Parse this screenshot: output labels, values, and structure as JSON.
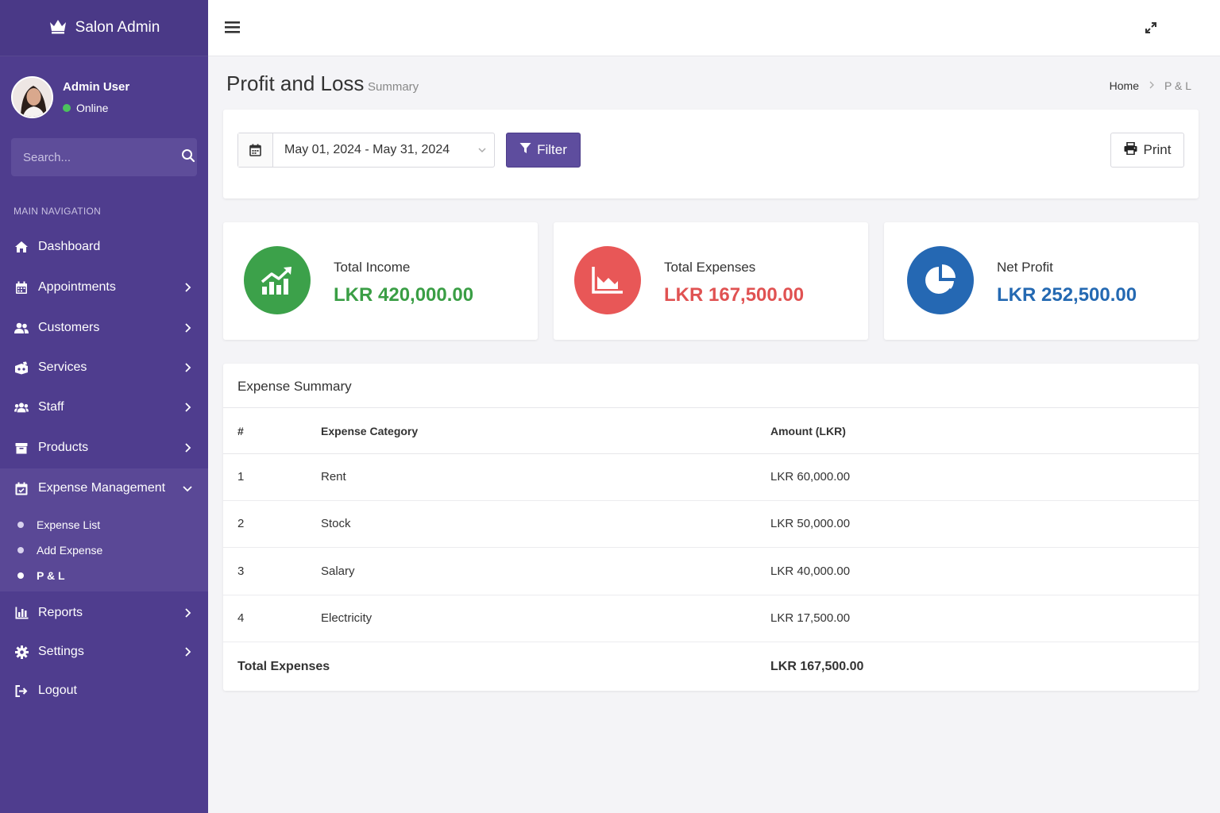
{
  "sidebar": {
    "brand": "Salon Admin",
    "user": {
      "name": "Admin User",
      "status": "Online"
    },
    "search_placeholder": "Search...",
    "nav_header": "MAIN NAVIGATION",
    "items": [
      {
        "label": "Dashboard",
        "icon": "home-icon"
      },
      {
        "label": "Appointments",
        "icon": "calendar-icon"
      },
      {
        "label": "Customers",
        "icon": "users-icon"
      },
      {
        "label": "Services",
        "icon": "services-icon"
      },
      {
        "label": "Staff",
        "icon": "staff-icon"
      },
      {
        "label": "Products",
        "icon": "box-icon"
      },
      {
        "label": "Expense Management",
        "icon": "wallet-icon"
      },
      {
        "label": "Reports",
        "icon": "bar-chart-icon"
      },
      {
        "label": "Settings",
        "icon": "gear-icon"
      },
      {
        "label": "Logout",
        "icon": "sign-out-icon"
      }
    ],
    "sub_items": [
      {
        "label": "Expense List"
      },
      {
        "label": "Add Expense"
      },
      {
        "label": "P & L"
      }
    ]
  },
  "header": {
    "title": "Profit and Loss",
    "subtitle": "Summary",
    "breadcrumb": {
      "home": "Home",
      "current": "P & L"
    }
  },
  "filter": {
    "date_range": "May 01, 2024 - May 31, 2024",
    "filter_label": "Filter",
    "print_label": "Print"
  },
  "stats": [
    {
      "label": "Total Income",
      "value": "LKR 420,000.00",
      "color": "#3a9e45"
    },
    {
      "label": "Total Expenses",
      "value": "LKR 167,500.00",
      "color": "#e05252"
    },
    {
      "label": "Net Profit",
      "value": "LKR 252,500.00",
      "color": "#2469b2"
    }
  ],
  "table": {
    "title": "Expense Summary",
    "columns": [
      "#",
      "Expense Category",
      "Amount (LKR)"
    ],
    "rows": [
      {
        "num": "1",
        "category": "Rent",
        "amount": "LKR 60,000.00"
      },
      {
        "num": "2",
        "category": "Stock",
        "amount": "LKR 50,000.00"
      },
      {
        "num": "3",
        "category": "Salary",
        "amount": "LKR 40,000.00"
      },
      {
        "num": "4",
        "category": "Electricity",
        "amount": "LKR 17,500.00"
      }
    ],
    "total_label": "Total Expenses",
    "total_value": "LKR 167,500.00"
  }
}
